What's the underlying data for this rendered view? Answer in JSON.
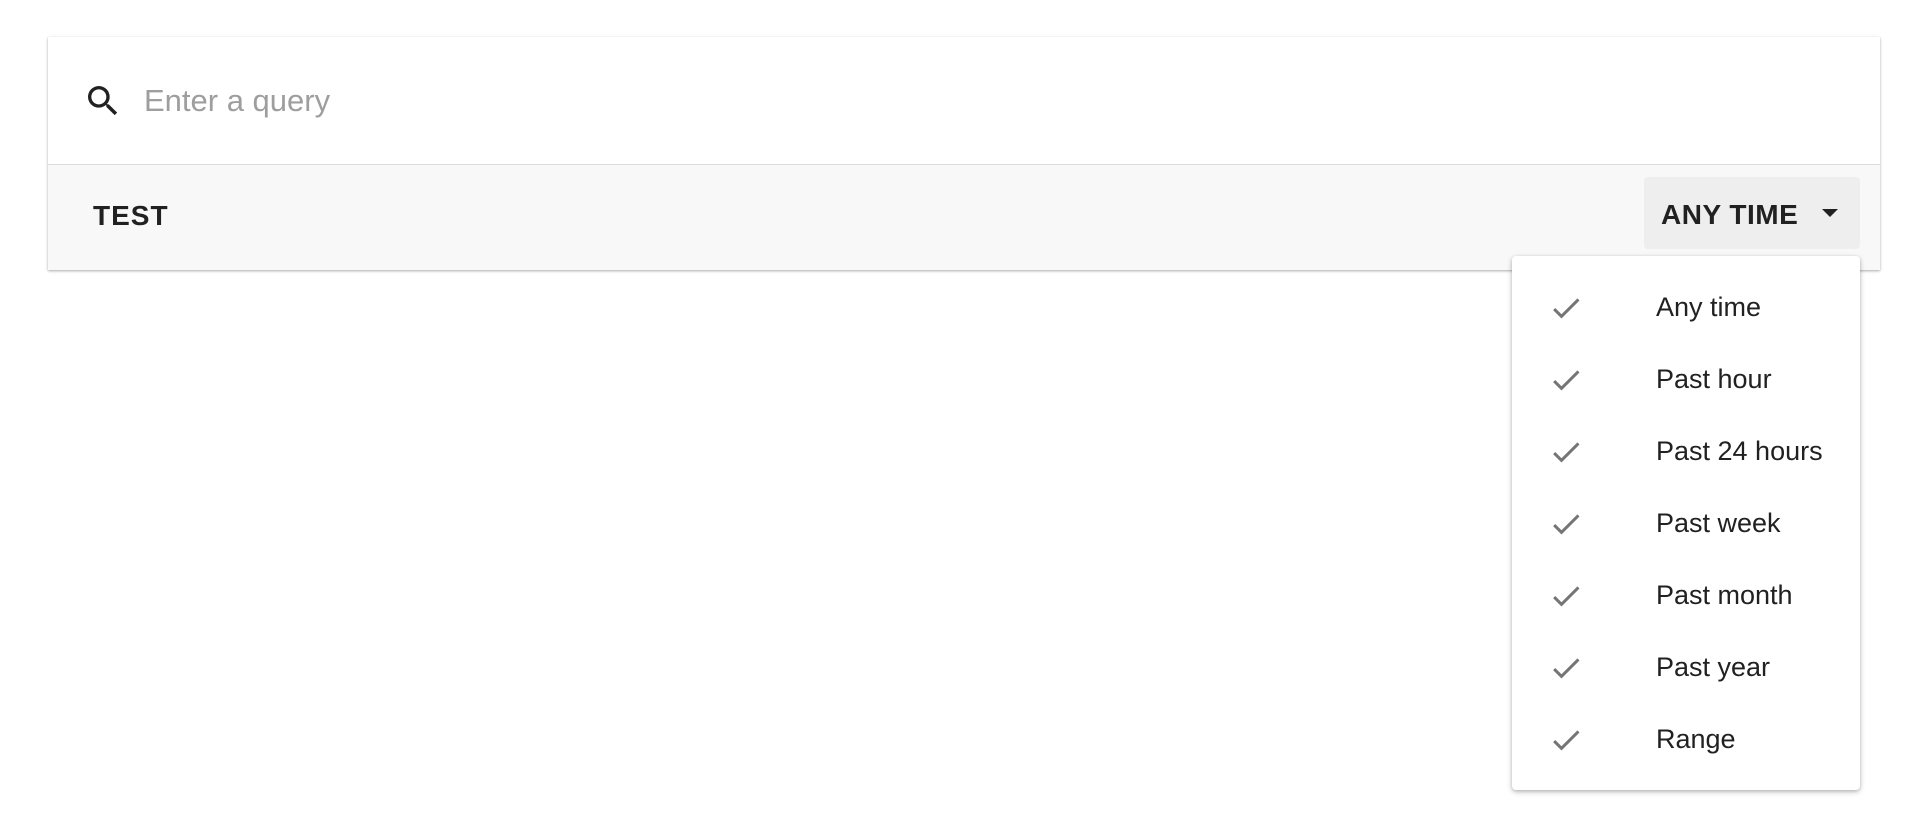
{
  "search": {
    "placeholder": "Enter a query",
    "value": ""
  },
  "filters": {
    "test_label": "TEST",
    "time_button_label": "ANY TIME"
  },
  "time_menu": {
    "items": [
      {
        "label": "Any time",
        "icon": "check-icon"
      },
      {
        "label": "Past hour",
        "icon": "check-icon"
      },
      {
        "label": "Past 24 hours",
        "icon": "check-icon"
      },
      {
        "label": "Past week",
        "icon": "check-icon"
      },
      {
        "label": "Past month",
        "icon": "check-icon"
      },
      {
        "label": "Past year",
        "icon": "check-icon"
      },
      {
        "label": "Range",
        "icon": "check-icon"
      }
    ]
  },
  "colors": {
    "check": "#757575",
    "text": "#212121",
    "placeholder": "#9e9e9e",
    "filter_bar": "#f8f8f8",
    "button_bg": "#eeeeee"
  }
}
